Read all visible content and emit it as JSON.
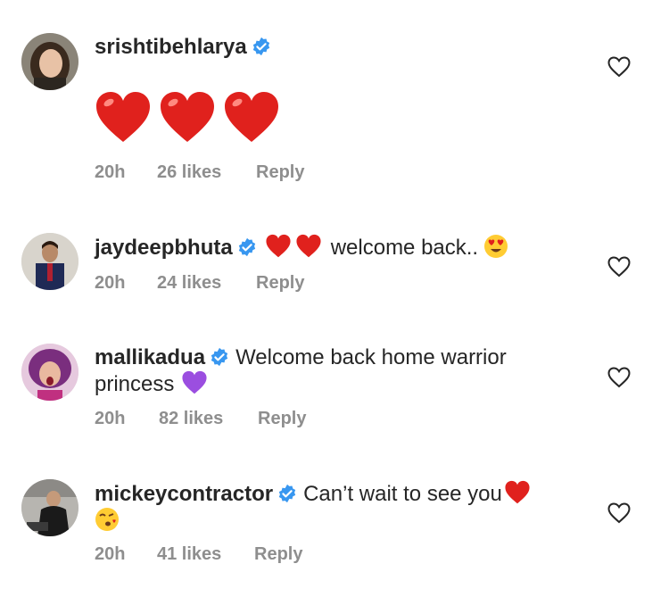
{
  "comments": [
    {
      "username": "srishtibehlarya",
      "text": "",
      "time": "20h",
      "likes": "26 likes",
      "reply": "Reply",
      "emoji_line": [
        "heart",
        "heart",
        "heart"
      ]
    },
    {
      "username": "jaydeepbhuta",
      "text": "welcome back..",
      "time": "20h",
      "likes": "24 likes",
      "reply": "Reply"
    },
    {
      "username": "mallikadua",
      "text": "Welcome back home warrior",
      "text2": "princess",
      "time": "20h",
      "likes": "82 likes",
      "reply": "Reply"
    },
    {
      "username": "mickeycontractor",
      "text": "Can’t wait to see you",
      "time": "20h",
      "likes": "41 likes",
      "reply": "Reply"
    }
  ],
  "colors": {
    "verified": "#3897f0",
    "meta": "#8e8e8e",
    "heart_red": "#e0211d",
    "purple_heart": "#9b4ee0"
  },
  "icons": [
    "verified-badge-icon",
    "like-heart-icon",
    "red-heart-emoji",
    "heart-eyes-emoji",
    "purple-heart-emoji",
    "kiss-emoji"
  ]
}
